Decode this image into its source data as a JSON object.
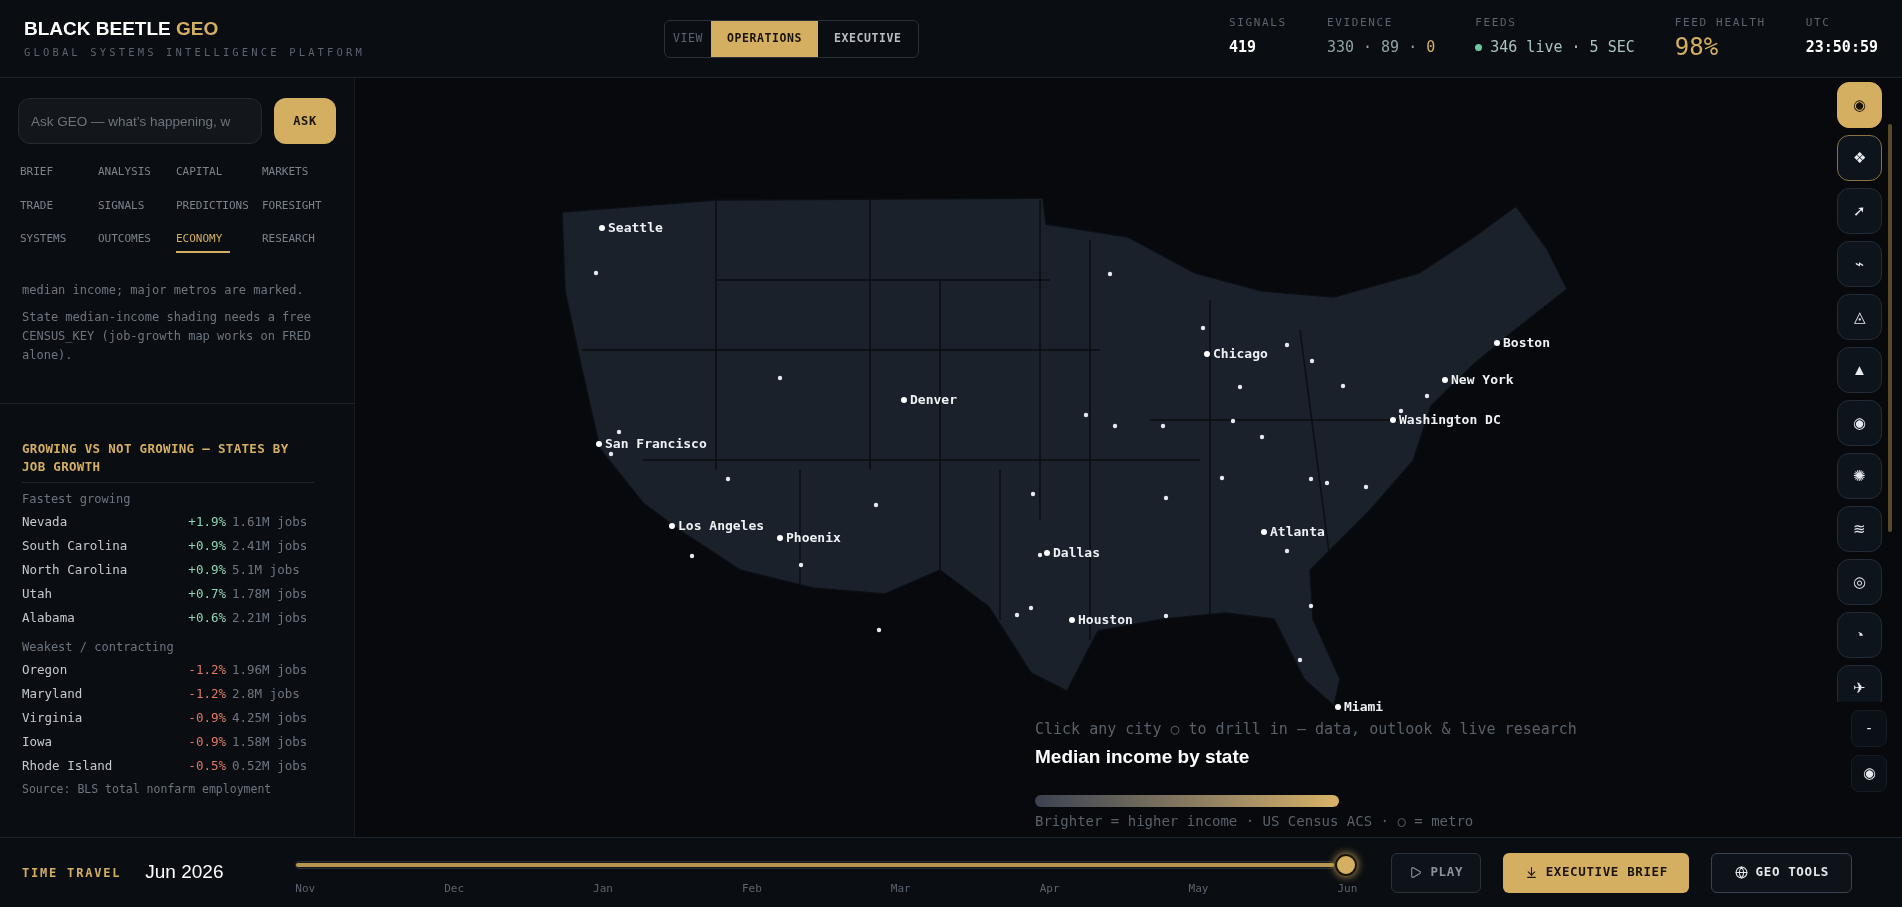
{
  "header": {
    "brand": "BLACK BEETLE",
    "brand_accent": "GEO",
    "subtitle": "GLOBAL SYSTEMS INTELLIGENCE PLATFORM",
    "view_label": "VIEW",
    "views": [
      {
        "label": "OPERATIONS",
        "selected": true
      },
      {
        "label": "EXECUTIVE",
        "selected": false
      }
    ],
    "stats": [
      {
        "label": "SIGNALS",
        "value": "419",
        "kind": "plain"
      },
      {
        "label": "EVIDENCE",
        "value": "330 · 89 ·",
        "accent": "0",
        "kind": "split"
      },
      {
        "label": "FEEDS",
        "value": "346 live · 5 SEC",
        "kind": "live"
      },
      {
        "label": "FEED HEALTH",
        "value": "98%",
        "kind": "big"
      },
      {
        "label": "UTC",
        "value": "23:50:59",
        "kind": "plain"
      }
    ]
  },
  "sidebar": {
    "ask": {
      "placeholder": "Ask GEO — what’s happening, w",
      "button": "ASK"
    },
    "tabs": [
      {
        "label": "BRIEF",
        "selected": false
      },
      {
        "label": "ANALYSIS",
        "selected": false
      },
      {
        "label": "CAPITAL",
        "selected": false
      },
      {
        "label": "MARKETS",
        "selected": false
      },
      {
        "label": "TRADE",
        "selected": false
      },
      {
        "label": "SIGNALS",
        "selected": false
      },
      {
        "label": "PREDICTIONS",
        "selected": false
      },
      {
        "label": "FORESIGHT",
        "selected": false
      },
      {
        "label": "SYSTEMS",
        "selected": false
      },
      {
        "label": "OUTCOMES",
        "selected": false
      },
      {
        "label": "ECONOMY",
        "selected": true
      },
      {
        "label": "RESEARCH",
        "selected": false
      }
    ],
    "notes": [
      "median income; major metros are marked.",
      "State median-income shading needs a free CENSUS_KEY (job-growth map works on FRED alone)."
    ],
    "growth": {
      "title": "GROWING VS NOT GROWING — STATES BY JOB GROWTH",
      "groups": [
        {
          "label": "Fastest growing",
          "kind": "growth",
          "rows": [
            {
              "state": "Nevada",
              "change": "+1.9%",
              "jobs": "1.61M jobs"
            },
            {
              "state": "South Carolina",
              "change": "+0.9%",
              "jobs": "2.41M jobs"
            },
            {
              "state": "North Carolina",
              "change": "+0.9%",
              "jobs": "5.1M jobs"
            },
            {
              "state": "Utah",
              "change": "+0.7%",
              "jobs": "1.78M jobs"
            },
            {
              "state": "Alabama",
              "change": "+0.6%",
              "jobs": "2.21M jobs"
            }
          ]
        },
        {
          "label": "Weakest / contracting",
          "kind": "contraction",
          "rows": [
            {
              "state": "Oregon",
              "change": "-1.2%",
              "jobs": "1.96M jobs"
            },
            {
              "state": "Maryland",
              "change": "-1.2%",
              "jobs": "2.8M jobs"
            },
            {
              "state": "Virginia",
              "change": "-0.9%",
              "jobs": "4.25M jobs"
            },
            {
              "state": "Iowa",
              "change": "-0.9%",
              "jobs": "1.58M jobs"
            },
            {
              "state": "Rhode Island",
              "change": "-0.5%",
              "jobs": "0.52M jobs"
            }
          ]
        }
      ],
      "source": "Source: BLS total nonfarm employment"
    }
  },
  "map": {
    "cities": [
      {
        "name": "Seattle"
      },
      {
        "name": "Boston"
      },
      {
        "name": "Chicago"
      },
      {
        "name": "New York"
      },
      {
        "name": "Denver"
      },
      {
        "name": "Washington DC"
      },
      {
        "name": "San Francisco"
      },
      {
        "name": "Los Angeles"
      },
      {
        "name": "Atlanta"
      },
      {
        "name": "Phoenix"
      },
      {
        "name": "Dallas"
      },
      {
        "name": "Houston"
      },
      {
        "name": "Miami"
      }
    ],
    "hint": "Click any city ○ to drill in — data, outlook & live research",
    "title": "Median income by state",
    "caption": "Brighter = higher income · US Census ACS · ○ = metro"
  },
  "toolbar": {
    "tools": [
      {
        "glyph": "◉",
        "selected": true,
        "focused": false
      },
      {
        "glyph": "❖",
        "selected": false,
        "focused": true
      },
      {
        "glyph": "➚",
        "selected": false,
        "focused": false
      },
      {
        "glyph": "⌁",
        "selected": false,
        "focused": false
      },
      {
        "glyph": "◬",
        "selected": false,
        "focused": false
      },
      {
        "glyph": "▲",
        "selected": false,
        "focused": false
      },
      {
        "glyph": "◉",
        "selected": false,
        "focused": false
      },
      {
        "glyph": "✺",
        "selected": false,
        "focused": false
      },
      {
        "glyph": "≋",
        "selected": false,
        "focused": false
      },
      {
        "glyph": "◎",
        "selected": false,
        "focused": false
      },
      {
        "glyph": "◔",
        "selected": false,
        "focused": false
      },
      {
        "glyph": "✈",
        "selected": false,
        "focused": false
      }
    ],
    "zoom": [
      "-",
      "◉"
    ]
  },
  "timeline": {
    "label": "TIME TRAVEL",
    "date": "Jun 2026",
    "level": 1,
    "months": [
      "Nov",
      "Dec",
      "Jan",
      "Feb",
      "Mar",
      "Apr",
      "May",
      "Jun"
    ],
    "buttons": [
      {
        "label": "PLAY",
        "kind": "ghost"
      },
      {
        "label": "EXECUTIVE BRIEF",
        "kind": "primary"
      },
      {
        "label": "GEO TOOLS",
        "kind": "outline"
      }
    ]
  }
}
